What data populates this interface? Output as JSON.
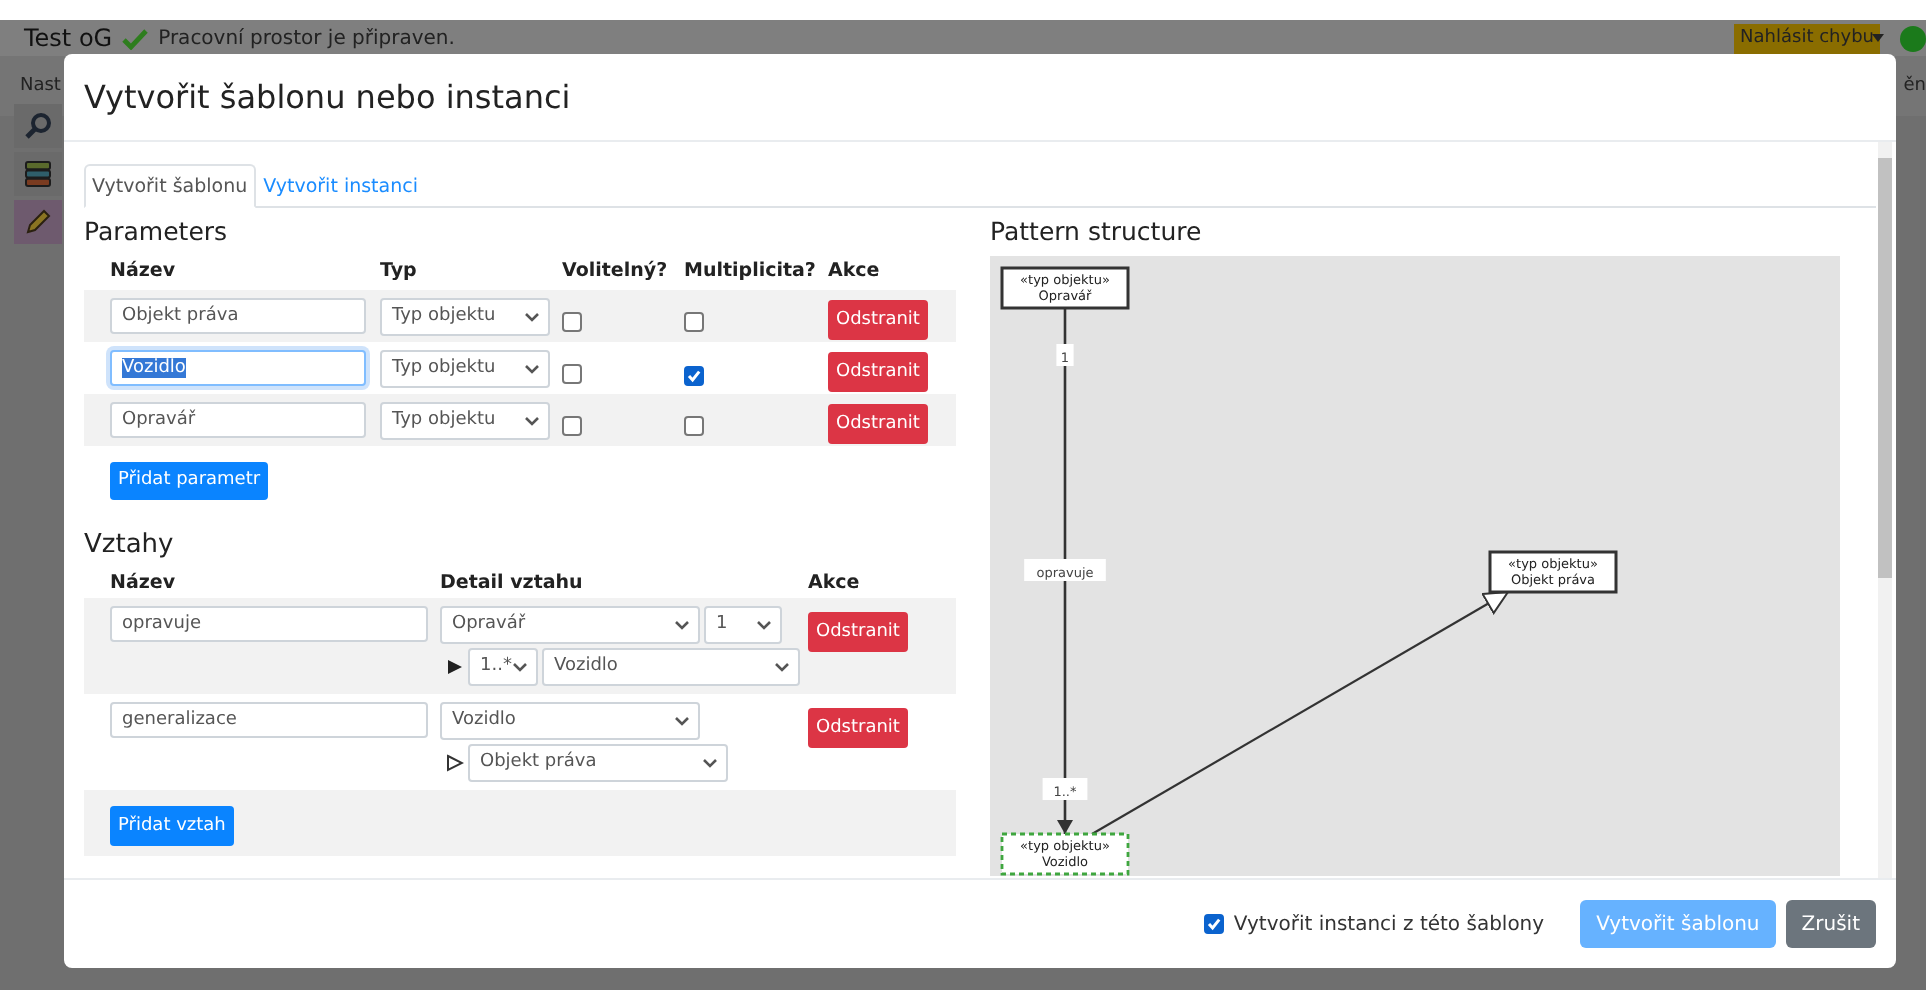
{
  "app_bar": {
    "title": "Test oG",
    "status": "Pracovní prostor je připraven.",
    "report_button": "Nahlásit chybu",
    "left_label": "Nast",
    "right_label": "ěn"
  },
  "sidebar": [
    {
      "kind": "search",
      "selected": false
    },
    {
      "kind": "database",
      "selected": false
    },
    {
      "kind": "edit",
      "selected": true
    }
  ],
  "dialog": {
    "title": "Vytvořit šablonu nebo instanci",
    "tabs": [
      {
        "label": "Vytvořit šablonu",
        "selected": true
      },
      {
        "label": "Vytvořit instanci",
        "selected": false
      }
    ],
    "parameters": {
      "heading": "Parameters",
      "columns": [
        "Název",
        "Typ",
        "Volitelný?",
        "Multiplicita?",
        "Akce"
      ],
      "rows": [
        {
          "name": "Objekt práva",
          "focused": false,
          "type": "Typ objektu",
          "optional": false,
          "multiplicity": false,
          "action": "Odstranit"
        },
        {
          "name": "Vozidlo",
          "focused": true,
          "type": "Typ objektu",
          "optional": false,
          "multiplicity": true,
          "action": "Odstranit"
        },
        {
          "name": "Opravář",
          "focused": false,
          "type": "Typ objektu",
          "optional": false,
          "multiplicity": false,
          "action": "Odstranit"
        }
      ],
      "add_button": "Přidat parametr"
    },
    "relations": {
      "heading": "Vztahy",
      "columns": [
        "Název",
        "Detail vztahu",
        "Akce"
      ],
      "rows": [
        {
          "name": "opravuje",
          "kind": "association",
          "source": "Opravář",
          "source_multiplicity": "1",
          "target_multiplicity": "1..*",
          "target": "Vozidlo",
          "action": "Odstranit"
        },
        {
          "name": "generalizace",
          "kind": "generalization",
          "source": "Vozidlo",
          "target": "Objekt práva",
          "action": "Odstranit"
        }
      ],
      "add_button": "Přidat vztah"
    },
    "structure": {
      "heading": "Pattern structure",
      "nodes": [
        {
          "stereotype": "«typ objektu»",
          "name": "Opravář",
          "selected": false
        },
        {
          "stereotype": "«typ objektu»",
          "name": "Objekt práva",
          "selected": false
        },
        {
          "stereotype": "«typ objektu»",
          "name": "Vozidlo",
          "selected": true
        }
      ],
      "edges": [
        {
          "kind": "association",
          "label": "opravuje",
          "from_multiplicity": "1",
          "to_multiplicity": "1..*"
        },
        {
          "kind": "generalization"
        }
      ]
    },
    "footer": {
      "checkbox": {
        "label": "Vytvořit instanci z této šablony",
        "checked": true
      },
      "buttons": [
        {
          "kind": "primary",
          "label": "Vytvořit šablonu",
          "disabled": true
        },
        {
          "kind": "secondary",
          "label": "Zrušit",
          "disabled": false
        }
      ]
    }
  }
}
